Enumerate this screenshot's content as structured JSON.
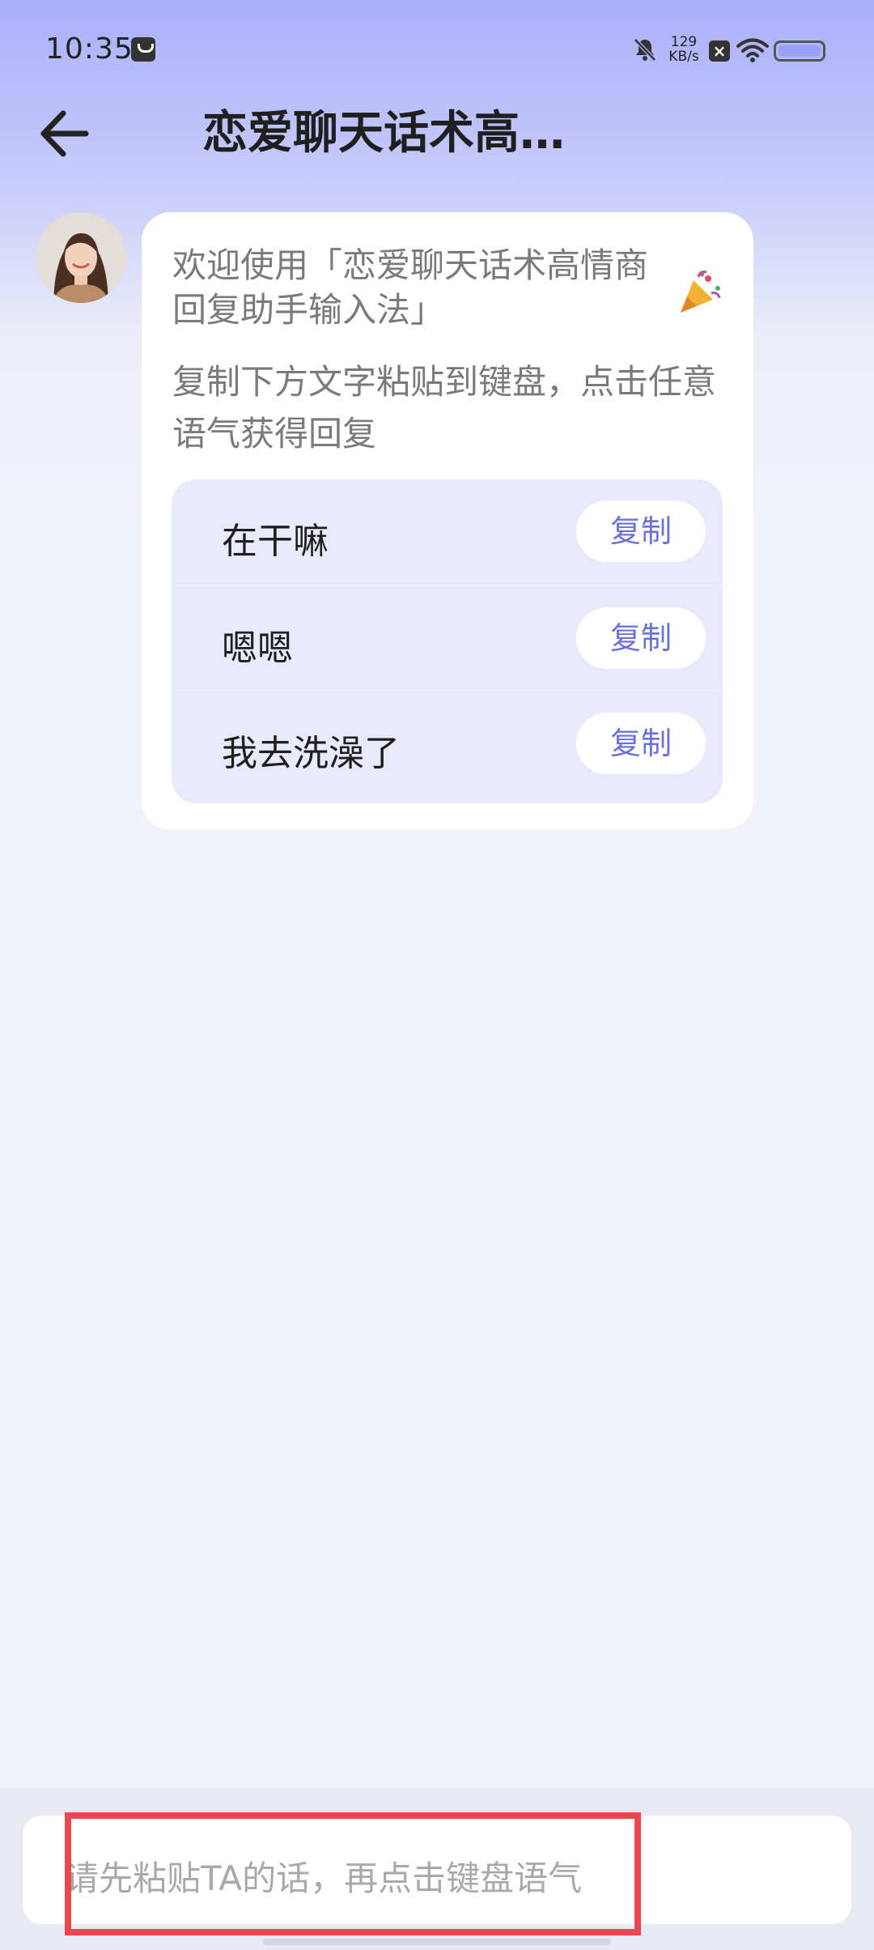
{
  "status_bar": {
    "time": "10:35",
    "net_speed_value": "129",
    "net_speed_unit": "KB/s",
    "icons": [
      "shopping-bag-icon",
      "bell-muted-icon",
      "close-box-icon",
      "wifi-icon",
      "battery-icon"
    ]
  },
  "header": {
    "title": "恋爱聊天话术高…",
    "back_icon": "arrow-left-icon"
  },
  "message": {
    "welcome": "欢迎使用「恋爱聊天话术高情商回复助手输入法」",
    "emoji": "party-popper-icon",
    "instructions": "复制下方文字粘贴到键盘，点击任意语气获得回复",
    "phrases": [
      {
        "text": "在干嘛",
        "button": "复制"
      },
      {
        "text": "嗯嗯",
        "button": "复制"
      },
      {
        "text": "我去洗澡了",
        "button": "复制"
      }
    ]
  },
  "input": {
    "placeholder": "请先粘贴TA的话，再点击键盘语气"
  },
  "colors": {
    "accent": "#6b72d9",
    "highlight": "#e8484f",
    "phrase_bg": "#e9ebfd"
  }
}
